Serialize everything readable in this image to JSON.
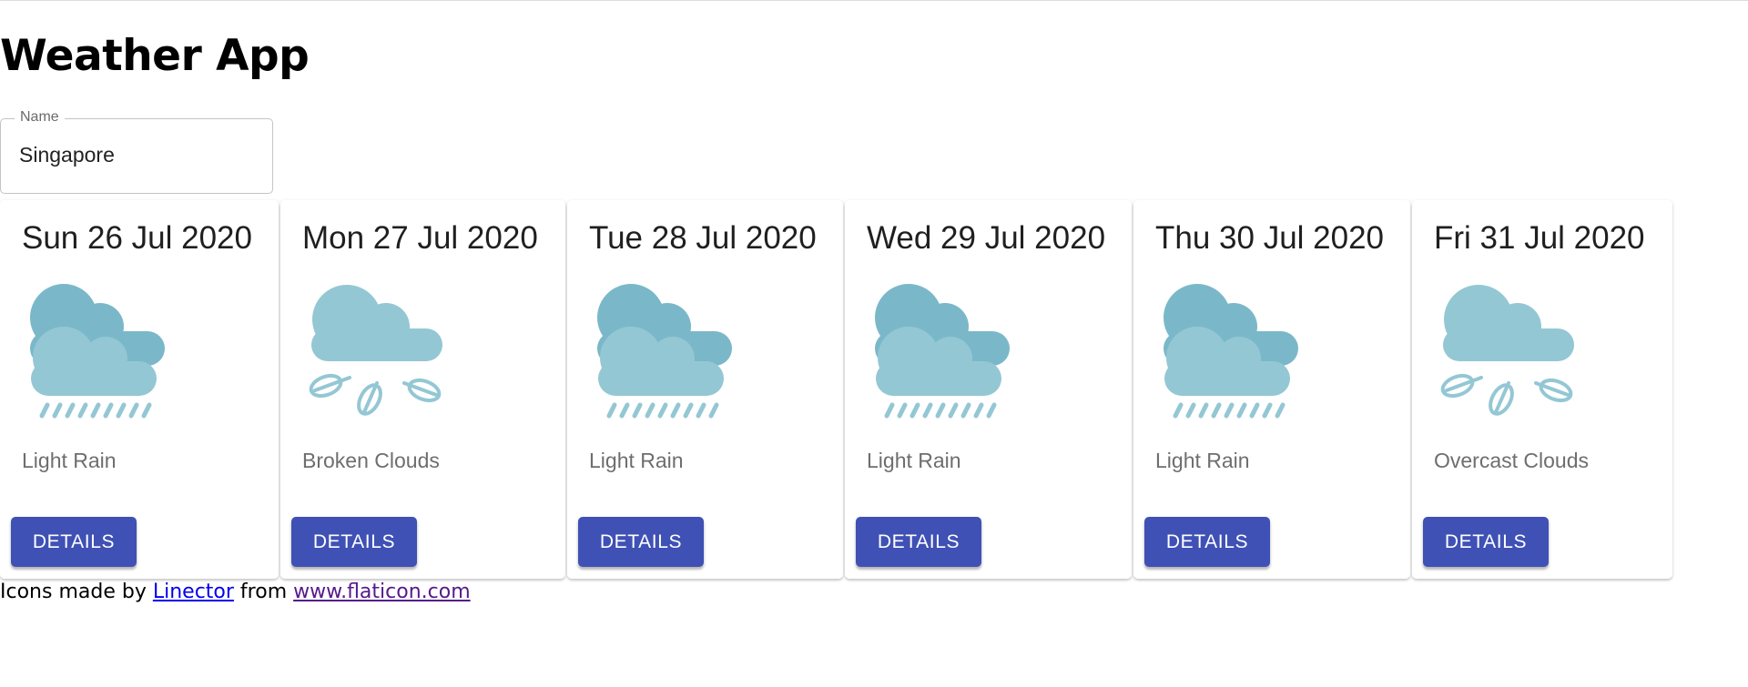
{
  "app": {
    "title": "Weather App"
  },
  "search": {
    "label": "Name",
    "value": "Singapore"
  },
  "colors": {
    "button": "#3f51b5",
    "cloud_dark": "#7ab8c9",
    "cloud_light": "#94c7d4"
  },
  "forecast": [
    {
      "date": "Sun 26 Jul 2020",
      "description": "Light Rain",
      "icon": "rain-cloud-icon",
      "button": "DETAILS"
    },
    {
      "date": "Mon 27 Jul 2020",
      "description": "Broken Clouds",
      "icon": "wind-cloud-icon",
      "button": "DETAILS"
    },
    {
      "date": "Tue 28 Jul 2020",
      "description": "Light Rain",
      "icon": "rain-cloud-icon",
      "button": "DETAILS"
    },
    {
      "date": "Wed 29 Jul 2020",
      "description": "Light Rain",
      "icon": "rain-cloud-icon",
      "button": "DETAILS"
    },
    {
      "date": "Thu 30 Jul 2020",
      "description": "Light Rain",
      "icon": "rain-cloud-icon",
      "button": "DETAILS"
    },
    {
      "date": "Fri 31 Jul 2020",
      "description": "Overcast Clouds",
      "icon": "wind-cloud-icon",
      "button": "DETAILS"
    }
  ],
  "attribution": {
    "prefix": "Icons made by",
    "author": "Linector",
    "middle": "from",
    "site": "www.flaticon.com"
  }
}
